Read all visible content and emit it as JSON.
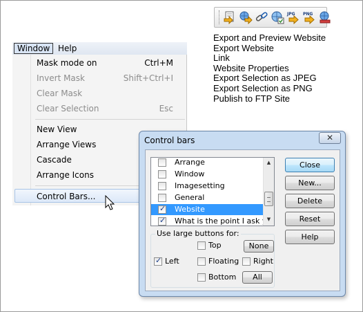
{
  "toolbar": {
    "icons": [
      "export-preview-icon",
      "export-website-icon",
      "link-icon",
      "website-properties-icon",
      "export-jpeg-icon",
      "export-png-icon",
      "publish-ftp-icon"
    ],
    "jpg_text": "JPG",
    "png_text": "PNG"
  },
  "legend": [
    "Export and Preview Website",
    "Export Website",
    "Link",
    "Website Properties",
    "Export Selection as JPEG",
    "Export Selection as PNG",
    "Publish to FTP Site"
  ],
  "menubar": {
    "window": "Window",
    "help": "Help"
  },
  "menu": {
    "items": [
      {
        "label": "Mask mode on",
        "shortcut": "Ctrl+M"
      },
      {
        "label": "Invert Mask",
        "shortcut": "Shift+Ctrl+I"
      },
      {
        "label": "Clear Mask",
        "shortcut": ""
      },
      {
        "label": "Clear Selection",
        "shortcut": "Esc"
      },
      {
        "label": "New View",
        "shortcut": ""
      },
      {
        "label": "Arrange Views",
        "shortcut": ""
      },
      {
        "label": "Cascade",
        "shortcut": ""
      },
      {
        "label": "Arrange Icons",
        "shortcut": ""
      },
      {
        "label": "Control Bars...",
        "shortcut": ""
      }
    ]
  },
  "dialog": {
    "title": "Control bars",
    "close_glyph": "✕",
    "list": [
      {
        "label": "Arrange",
        "checked": false
      },
      {
        "label": "Window",
        "checked": false
      },
      {
        "label": "Imagesetting",
        "checked": false
      },
      {
        "label": "General",
        "checked": false
      },
      {
        "label": "Website",
        "checked": true
      },
      {
        "label": "What is the point I ask you",
        "checked": true
      }
    ],
    "buttons": {
      "close": "Close",
      "new": "New...",
      "delete": "Delete",
      "reset": "Reset",
      "help": "Help"
    },
    "group_title": "Use large buttons for:",
    "options": {
      "top": "Top",
      "left": "Left",
      "floating": "Floating",
      "right": "Right",
      "bottom": "Bottom"
    },
    "none_label": "None",
    "all_label": "All"
  }
}
